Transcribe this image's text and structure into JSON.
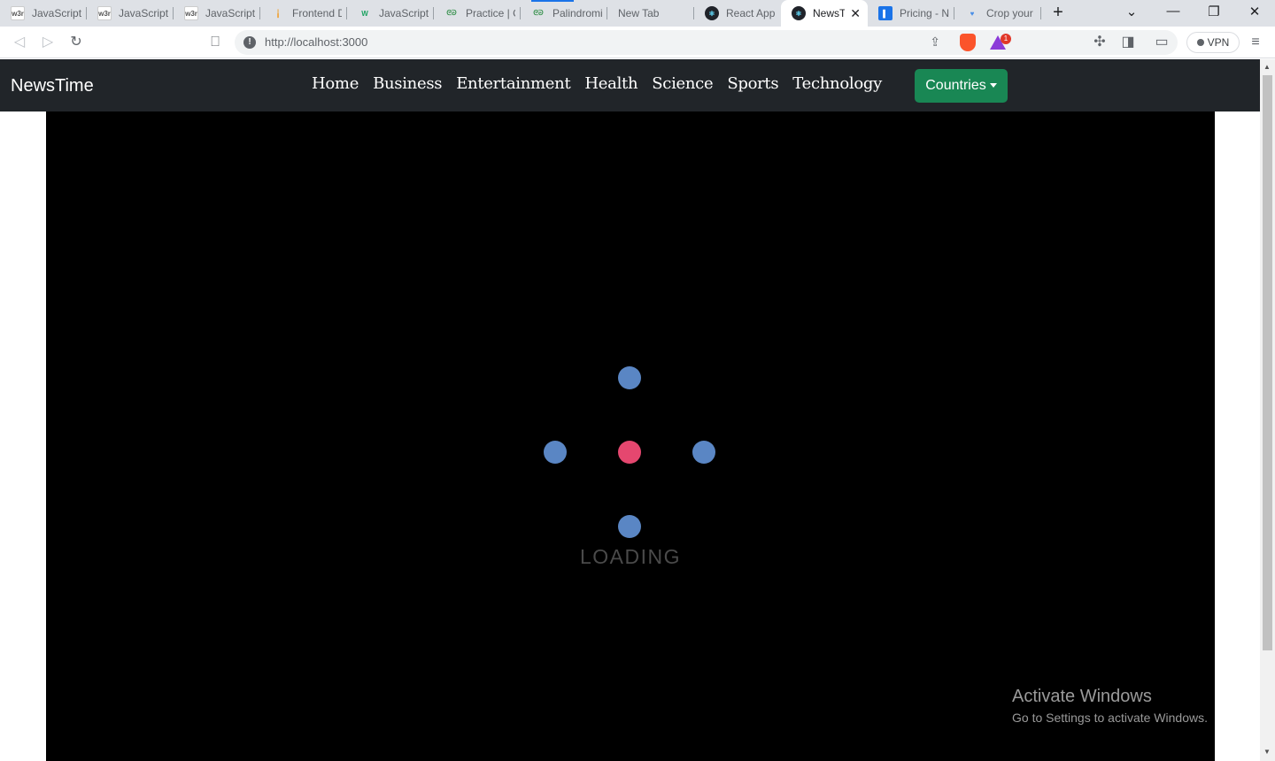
{
  "browser": {
    "tabs": [
      {
        "title": "JavaScript c",
        "icon": "w3schools-icon"
      },
      {
        "title": "JavaScript c",
        "icon": "w3schools-icon"
      },
      {
        "title": "JavaScript c",
        "icon": "w3schools-icon"
      },
      {
        "title": "Frontend De",
        "icon": "frontend-icon"
      },
      {
        "title": "JavaScript H",
        "icon": "webdev-icon"
      },
      {
        "title": "Practice | G",
        "icon": "geeksforgeeks-icon"
      },
      {
        "title": "Palindromic",
        "icon": "geeksforgeeks-icon"
      },
      {
        "title": "New Tab",
        "icon": ""
      },
      {
        "title": "React App",
        "icon": "react-icon"
      },
      {
        "title": "NewsTime",
        "icon": "react-icon",
        "active": true
      },
      {
        "title": "Pricing - Ne",
        "icon": "pricing-icon"
      },
      {
        "title": "Crop your i",
        "icon": "crop-icon"
      }
    ],
    "new_tab": "+",
    "url": "http://localhost:3000",
    "vpn_label": "VPN",
    "rewards_badge": "1"
  },
  "navbar": {
    "brand": "NewsTime",
    "links": [
      "Home",
      "Business",
      "Entertainment",
      "Health",
      "Science",
      "Sports",
      "Technology"
    ],
    "dropdown_label": "Countries",
    "bg_color": "#212529",
    "button_color": "#198754"
  },
  "loader": {
    "text": "LOADING",
    "dot_color": "#5a86c4",
    "center_color": "#e5476f"
  },
  "watermark": {
    "line1": "Activate Windows",
    "line2": "Go to Settings to activate Windows."
  }
}
